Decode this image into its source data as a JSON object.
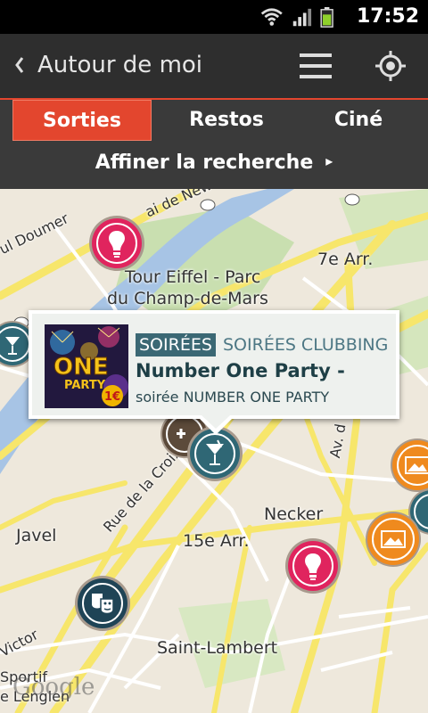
{
  "status_bar": {
    "time": "17:52",
    "icons": [
      "wifi-icon",
      "signal-icon",
      "battery-icon"
    ]
  },
  "action_bar": {
    "title": "Autour de moi",
    "menu_icon": "menu-icon",
    "locate_icon": "locate-icon"
  },
  "tabs": [
    {
      "label": "Sorties",
      "active": true
    },
    {
      "label": "Restos",
      "active": false
    },
    {
      "label": "Ciné",
      "active": false
    }
  ],
  "refine": {
    "label": "Affiner la recherche"
  },
  "map": {
    "labels": {
      "eiffel_1": "Tour Eiffel - Parc",
      "eiffel_2": "du Champ-de-Mars",
      "arr7": "7e Arr.",
      "arr15": "15e Arr.",
      "necker": "Necker",
      "javel": "Javel",
      "saint_lambert": "Saint-Lambert",
      "croix": "Rue de la Croix N",
      "doumer": "ul Doumer",
      "quai_new": "ai de New",
      "victor": "Victor",
      "sportif": "Sportif",
      "lenglen": "e Lenglen",
      "av": "Av. d",
      "google": "Google"
    }
  },
  "popup": {
    "category": "SOIRÉES",
    "subcategory": "SOIRÉES CLUBBING",
    "title": "Number One Party -",
    "description": "soirée NUMBER ONE PARTY",
    "thumb_text_1": "ONE",
    "thumb_text_2": "PARTY",
    "thumb_price": "1€"
  },
  "colors": {
    "accent": "#e3462e",
    "marker_pink": "#e0245e",
    "marker_teal": "#2f6775",
    "marker_orange": "#ef8a1e",
    "marker_brown": "#5c4a3a"
  }
}
